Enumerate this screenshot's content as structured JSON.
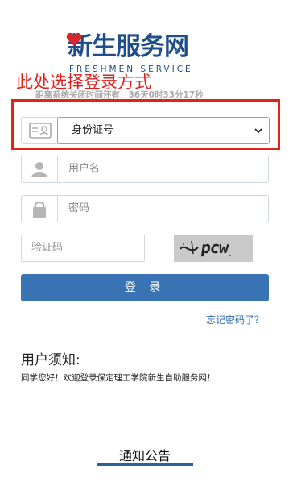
{
  "logo": {
    "main": "新生服务网",
    "sub": "FRESHMEN SERVICE"
  },
  "countdown": "距离系统关闭时间还有：36天0时33分17秒",
  "annotation": "此处选择登录方式",
  "login_type": {
    "selected": "身份证号"
  },
  "username": {
    "placeholder": "用户名"
  },
  "password": {
    "placeholder": "密码"
  },
  "captcha": {
    "placeholder": "验证码",
    "image_text": "pcw"
  },
  "login_button": "登 录",
  "forgot_link": "忘记密码了？",
  "notice": {
    "title": "用户须知:",
    "text": "同学您好！欢迎登录保定理工学院新生自助服务网！"
  },
  "announcement": "通知公告",
  "colors": {
    "brand": "#1f4e8a",
    "button": "#3a73b3",
    "annotation": "#e52216"
  },
  "icons": [
    "id-card-icon",
    "user-icon",
    "lock-icon",
    "chevron-down-icon",
    "heart-icon"
  ]
}
